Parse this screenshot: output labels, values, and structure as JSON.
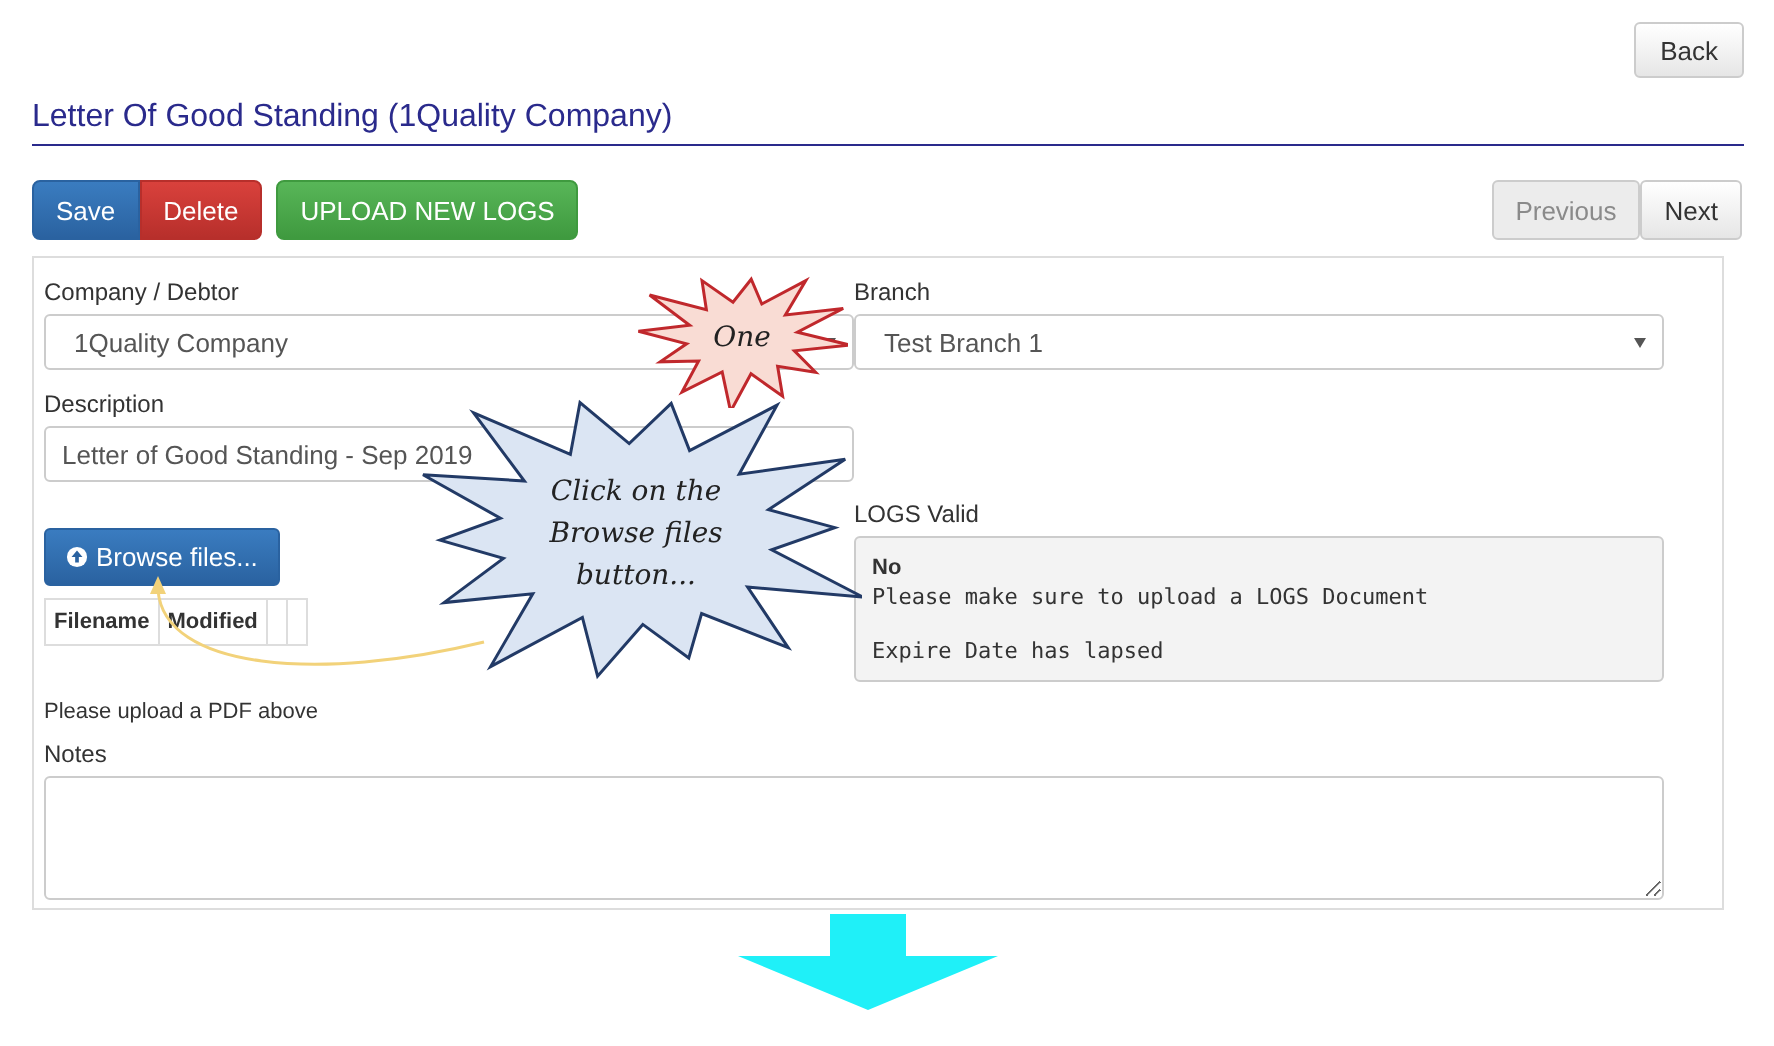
{
  "back_button": "Back",
  "title": "Letter Of Good Standing (1Quality Company)",
  "toolbar": {
    "buttons": [
      {
        "label": "Save",
        "kind": "primary"
      },
      {
        "label": "Delete",
        "kind": "danger"
      },
      {
        "label": "UPLOAD NEW LOGS",
        "kind": "success"
      }
    ],
    "nav": [
      {
        "label": "Previous",
        "disabled": true
      },
      {
        "label": "Next",
        "disabled": false
      }
    ]
  },
  "form": {
    "company": {
      "label": "Company / Debtor",
      "value": "1Quality Company"
    },
    "branch": {
      "label": "Branch",
      "value": "Test Branch 1"
    },
    "description": {
      "label": "Description",
      "value": "Letter of Good Standing - Sep 2019"
    },
    "browse_button": "Browse files...",
    "file_table": {
      "columns": [
        "Filename",
        "Modified"
      ]
    },
    "logs_valid": {
      "label": "LOGS Valid",
      "status": "No",
      "messages": [
        "Please make sure to upload a LOGS Document",
        "Expire Date has lapsed"
      ]
    },
    "upload_hint": "Please upload a PDF above",
    "notes": {
      "label": "Notes"
    }
  },
  "callouts": [
    {
      "lines": [
        "One"
      ],
      "color": "#f9dcd4"
    },
    {
      "lines": [
        "Click on the",
        "Browse files",
        "button..."
      ],
      "color": "#dbe5f3"
    }
  ]
}
